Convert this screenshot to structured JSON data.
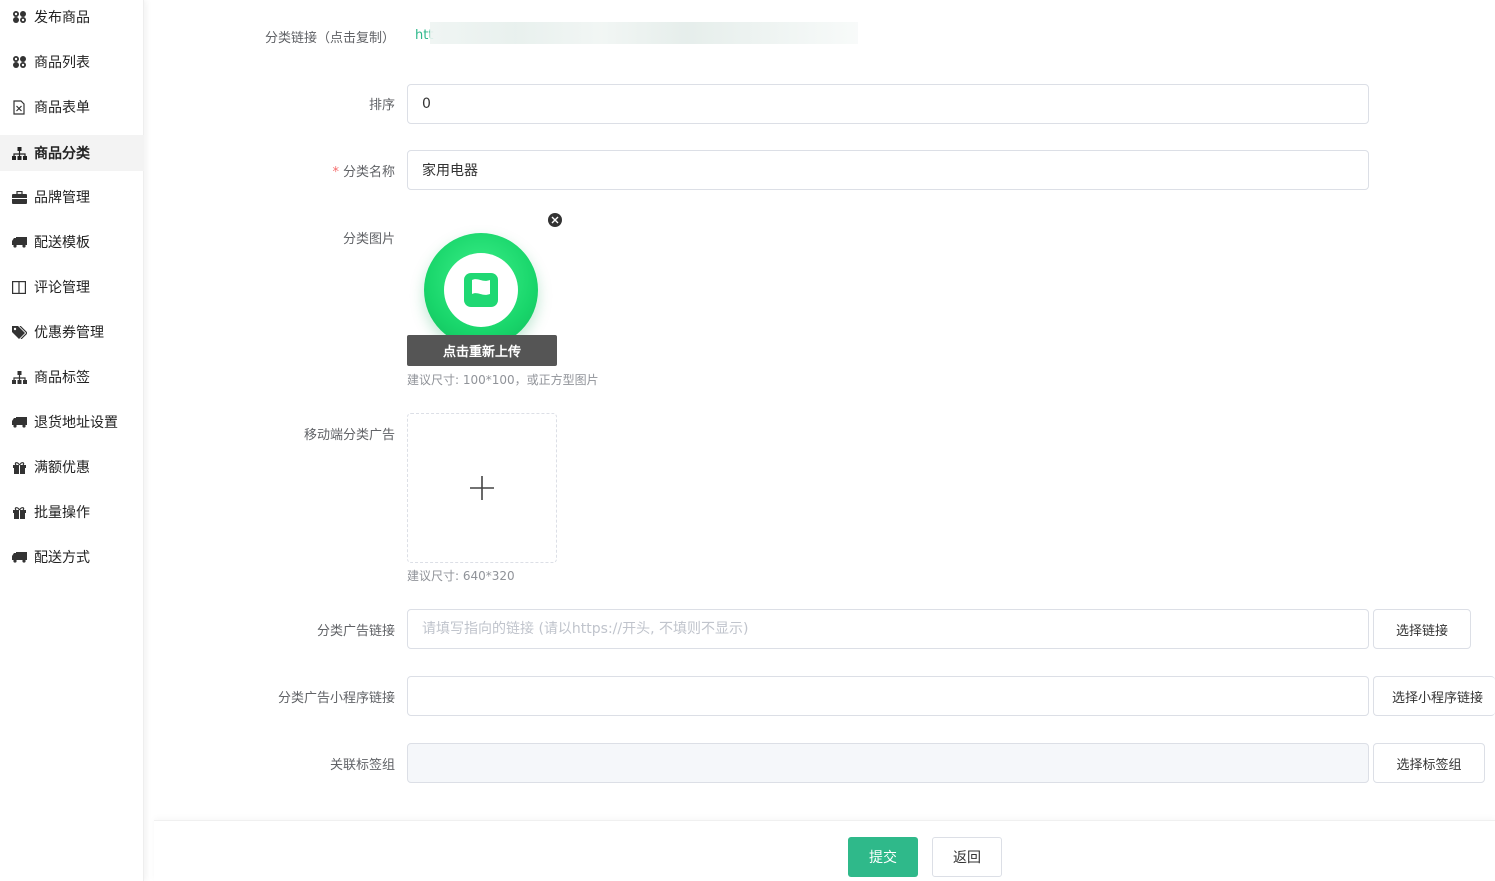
{
  "sidebar": {
    "items": [
      {
        "label": "发布商品",
        "icon": "cubes-icon"
      },
      {
        "label": "商品列表",
        "icon": "cubes-icon"
      },
      {
        "label": "商品表单",
        "icon": "excel-file-icon"
      },
      {
        "label": "商品分类",
        "icon": "sitemap-icon",
        "active": true
      },
      {
        "label": "品牌管理",
        "icon": "briefcase-icon"
      },
      {
        "label": "配送模板",
        "icon": "truck-icon"
      },
      {
        "label": "评论管理",
        "icon": "columns-icon"
      },
      {
        "label": "优惠券管理",
        "icon": "tags-icon"
      },
      {
        "label": "商品标签",
        "icon": "sitemap-icon"
      },
      {
        "label": "退货地址设置",
        "icon": "truck-icon"
      },
      {
        "label": "满额优惠",
        "icon": "gift-icon"
      },
      {
        "label": "批量操作",
        "icon": "gift-icon"
      },
      {
        "label": "配送方式",
        "icon": "truck-icon"
      }
    ]
  },
  "form": {
    "link": {
      "label": "分类链接（点击复制）",
      "value": "htt"
    },
    "sort": {
      "label": "排序",
      "value": "0"
    },
    "name": {
      "label": "分类名称",
      "required_mark": "*",
      "value": "家用电器"
    },
    "image": {
      "label": "分类图片",
      "reupload": "点击重新上传",
      "hint": "建议尺寸: 100*100，或正方型图片"
    },
    "mobile_ad": {
      "label": "移动端分类广告",
      "hint": "建议尺寸: 640*320"
    },
    "ad_link": {
      "label": "分类广告链接",
      "placeholder": "请填写指向的链接 (请以https://开头, 不填则不显示)",
      "button": "选择链接"
    },
    "ad_mini_link": {
      "label": "分类广告小程序链接",
      "value": "",
      "button": "选择小程序链接"
    },
    "tag_group": {
      "label": "关联标签组",
      "value": "",
      "button": "选择标签组"
    }
  },
  "footer": {
    "submit": "提交",
    "back": "返回"
  },
  "colors": {
    "primary": "#2fb98a",
    "link": "#2db88b",
    "required": "#f56c6c"
  }
}
